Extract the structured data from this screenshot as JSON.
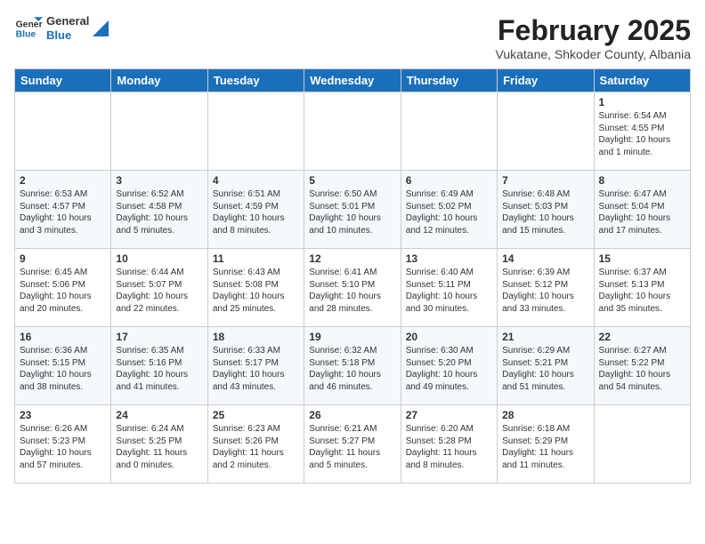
{
  "header": {
    "logo": {
      "general": "General",
      "blue": "Blue"
    },
    "title": "February 2025",
    "location": "Vukatane, Shkoder County, Albania"
  },
  "weekdays": [
    "Sunday",
    "Monday",
    "Tuesday",
    "Wednesday",
    "Thursday",
    "Friday",
    "Saturday"
  ],
  "weeks": [
    [
      {
        "day": "",
        "info": ""
      },
      {
        "day": "",
        "info": ""
      },
      {
        "day": "",
        "info": ""
      },
      {
        "day": "",
        "info": ""
      },
      {
        "day": "",
        "info": ""
      },
      {
        "day": "",
        "info": ""
      },
      {
        "day": "1",
        "info": "Sunrise: 6:54 AM\nSunset: 4:55 PM\nDaylight: 10 hours and 1 minute."
      }
    ],
    [
      {
        "day": "2",
        "info": "Sunrise: 6:53 AM\nSunset: 4:57 PM\nDaylight: 10 hours and 3 minutes."
      },
      {
        "day": "3",
        "info": "Sunrise: 6:52 AM\nSunset: 4:58 PM\nDaylight: 10 hours and 5 minutes."
      },
      {
        "day": "4",
        "info": "Sunrise: 6:51 AM\nSunset: 4:59 PM\nDaylight: 10 hours and 8 minutes."
      },
      {
        "day": "5",
        "info": "Sunrise: 6:50 AM\nSunset: 5:01 PM\nDaylight: 10 hours and 10 minutes."
      },
      {
        "day": "6",
        "info": "Sunrise: 6:49 AM\nSunset: 5:02 PM\nDaylight: 10 hours and 12 minutes."
      },
      {
        "day": "7",
        "info": "Sunrise: 6:48 AM\nSunset: 5:03 PM\nDaylight: 10 hours and 15 minutes."
      },
      {
        "day": "8",
        "info": "Sunrise: 6:47 AM\nSunset: 5:04 PM\nDaylight: 10 hours and 17 minutes."
      }
    ],
    [
      {
        "day": "9",
        "info": "Sunrise: 6:45 AM\nSunset: 5:06 PM\nDaylight: 10 hours and 20 minutes."
      },
      {
        "day": "10",
        "info": "Sunrise: 6:44 AM\nSunset: 5:07 PM\nDaylight: 10 hours and 22 minutes."
      },
      {
        "day": "11",
        "info": "Sunrise: 6:43 AM\nSunset: 5:08 PM\nDaylight: 10 hours and 25 minutes."
      },
      {
        "day": "12",
        "info": "Sunrise: 6:41 AM\nSunset: 5:10 PM\nDaylight: 10 hours and 28 minutes."
      },
      {
        "day": "13",
        "info": "Sunrise: 6:40 AM\nSunset: 5:11 PM\nDaylight: 10 hours and 30 minutes."
      },
      {
        "day": "14",
        "info": "Sunrise: 6:39 AM\nSunset: 5:12 PM\nDaylight: 10 hours and 33 minutes."
      },
      {
        "day": "15",
        "info": "Sunrise: 6:37 AM\nSunset: 5:13 PM\nDaylight: 10 hours and 35 minutes."
      }
    ],
    [
      {
        "day": "16",
        "info": "Sunrise: 6:36 AM\nSunset: 5:15 PM\nDaylight: 10 hours and 38 minutes."
      },
      {
        "day": "17",
        "info": "Sunrise: 6:35 AM\nSunset: 5:16 PM\nDaylight: 10 hours and 41 minutes."
      },
      {
        "day": "18",
        "info": "Sunrise: 6:33 AM\nSunset: 5:17 PM\nDaylight: 10 hours and 43 minutes."
      },
      {
        "day": "19",
        "info": "Sunrise: 6:32 AM\nSunset: 5:18 PM\nDaylight: 10 hours and 46 minutes."
      },
      {
        "day": "20",
        "info": "Sunrise: 6:30 AM\nSunset: 5:20 PM\nDaylight: 10 hours and 49 minutes."
      },
      {
        "day": "21",
        "info": "Sunrise: 6:29 AM\nSunset: 5:21 PM\nDaylight: 10 hours and 51 minutes."
      },
      {
        "day": "22",
        "info": "Sunrise: 6:27 AM\nSunset: 5:22 PM\nDaylight: 10 hours and 54 minutes."
      }
    ],
    [
      {
        "day": "23",
        "info": "Sunrise: 6:26 AM\nSunset: 5:23 PM\nDaylight: 10 hours and 57 minutes."
      },
      {
        "day": "24",
        "info": "Sunrise: 6:24 AM\nSunset: 5:25 PM\nDaylight: 11 hours and 0 minutes."
      },
      {
        "day": "25",
        "info": "Sunrise: 6:23 AM\nSunset: 5:26 PM\nDaylight: 11 hours and 2 minutes."
      },
      {
        "day": "26",
        "info": "Sunrise: 6:21 AM\nSunset: 5:27 PM\nDaylight: 11 hours and 5 minutes."
      },
      {
        "day": "27",
        "info": "Sunrise: 6:20 AM\nSunset: 5:28 PM\nDaylight: 11 hours and 8 minutes."
      },
      {
        "day": "28",
        "info": "Sunrise: 6:18 AM\nSunset: 5:29 PM\nDaylight: 11 hours and 11 minutes."
      },
      {
        "day": "",
        "info": ""
      }
    ]
  ]
}
